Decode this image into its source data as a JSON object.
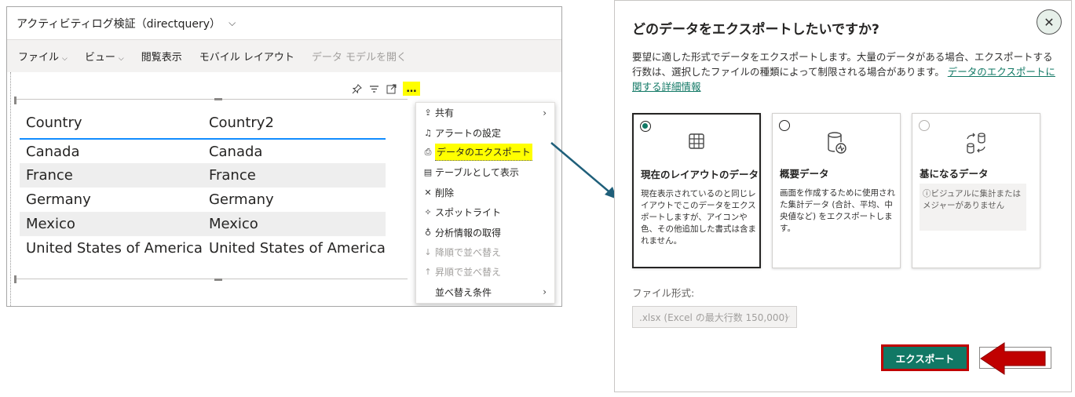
{
  "report": {
    "title": "アクティビティログ検証（directquery）",
    "menu": [
      {
        "label": "ファイル",
        "has_dropdown": true,
        "disabled": false
      },
      {
        "label": "ビュー",
        "has_dropdown": true,
        "disabled": false
      },
      {
        "label": "閲覧表示",
        "has_dropdown": false,
        "disabled": false
      },
      {
        "label": "モバイル レイアウト",
        "has_dropdown": false,
        "disabled": false
      },
      {
        "label": "データ モデルを開く",
        "has_dropdown": false,
        "disabled": true
      }
    ],
    "visual_toolbar": {
      "icons": [
        "pin-icon",
        "filter-icon",
        "focus-mode-icon",
        "more-options-icon"
      ],
      "more_label": "…"
    },
    "table": {
      "headers": [
        "Country",
        "Country2"
      ],
      "rows": [
        [
          "Canada",
          "Canada"
        ],
        [
          "France",
          "France"
        ],
        [
          "Germany",
          "Germany"
        ],
        [
          "Mexico",
          "Mexico"
        ],
        [
          "United States of America",
          "United States of America"
        ]
      ]
    },
    "context_menu": [
      {
        "label": "共有",
        "icon": "share-icon",
        "submenu": true,
        "disabled": false,
        "highlight": false
      },
      {
        "label": "アラートの設定",
        "icon": "bell-icon",
        "submenu": false,
        "disabled": false,
        "highlight": false
      },
      {
        "label": "データのエクスポート",
        "icon": "export-icon",
        "submenu": false,
        "disabled": false,
        "highlight": true
      },
      {
        "label": "テーブルとして表示",
        "icon": "table-view-icon",
        "submenu": false,
        "disabled": false,
        "highlight": false
      },
      {
        "label": "削除",
        "icon": "close-icon",
        "submenu": false,
        "disabled": false,
        "highlight": false
      },
      {
        "label": "スポットライト",
        "icon": "spotlight-icon",
        "submenu": false,
        "disabled": false,
        "highlight": false
      },
      {
        "label": "分析情報の取得",
        "icon": "lightbulb-icon",
        "submenu": false,
        "disabled": false,
        "highlight": false
      },
      {
        "label": "降順で並べ替え",
        "icon": "sort-desc-icon",
        "submenu": false,
        "disabled": true,
        "highlight": false
      },
      {
        "label": "昇順で並べ替え",
        "icon": "sort-asc-icon",
        "submenu": false,
        "disabled": true,
        "highlight": false
      },
      {
        "label": "並べ替え条件",
        "icon": "",
        "submenu": true,
        "disabled": false,
        "highlight": false
      }
    ]
  },
  "dialog": {
    "title": "どのデータをエクスポートしたいですか?",
    "description": "要望に適した形式でデータをエクスポートします。大量のデータがある場合、エクスポートする行数は、選択したファイルの種類によって制限される場合があります。",
    "link_text": "データのエクスポートに関する詳細情報",
    "close_label": "✕",
    "options": [
      {
        "title": "現在のレイアウトのデータ",
        "desc": "現在表示されているのと同じレイアウトでこのデータをエクスポートしますが、アイコンや色、その他追加した書式は含まれません。",
        "note": "",
        "selected": true,
        "disabled": false,
        "icon": "table-grid-icon"
      },
      {
        "title": "概要データ",
        "desc": "画面を作成するために使用された集計データ (合計、平均、中央値など) をエクスポートします。",
        "note": "",
        "selected": false,
        "disabled": false,
        "icon": "database-chart-icon"
      },
      {
        "title": "基になるデータ",
        "desc": "",
        "note": "ⓘビジュアルに集計またはメジャーがありません",
        "selected": false,
        "disabled": true,
        "icon": "data-transfer-icon"
      }
    ],
    "file_format_label": "ファイル形式:",
    "file_format_value": ".xlsx (Excel の最大行数 150,000)",
    "export_label": "エクスポート",
    "cancel_label": ""
  },
  "colors": {
    "accent": "#117865",
    "highlight": "#ffff00",
    "annotation_red": "#c00000",
    "table_header_line": "#118dff"
  }
}
